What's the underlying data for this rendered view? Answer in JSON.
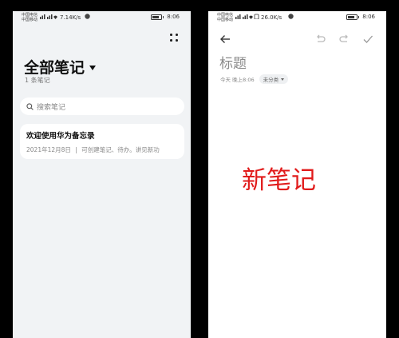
{
  "left_screen": {
    "status": {
      "carrier_line1": "中国电信",
      "carrier_line2": "中国移动",
      "speed": "7.14K/s",
      "time": "8:06"
    },
    "title": "全部笔记",
    "note_count": "1 条笔记",
    "search": {
      "placeholder": "搜索笔记"
    },
    "notes": [
      {
        "title": "欢迎使用华为备忘录",
        "date": "2021年12月8日",
        "separator": "|",
        "preview": "可创建笔记、待办。讲见新功"
      }
    ]
  },
  "right_screen": {
    "status": {
      "carrier_line1": "中国电信",
      "carrier_line2": "中国移动",
      "speed": "26.0K/s",
      "time": "8:06"
    },
    "editor": {
      "title_placeholder": "标题",
      "timestamp": "今天 晚上8:06",
      "category": "未分类"
    },
    "annotation": "新笔记"
  },
  "colors": {
    "left_background": "#f1f3f5",
    "right_background": "#ffffff",
    "annotation": "#e11b1b"
  }
}
